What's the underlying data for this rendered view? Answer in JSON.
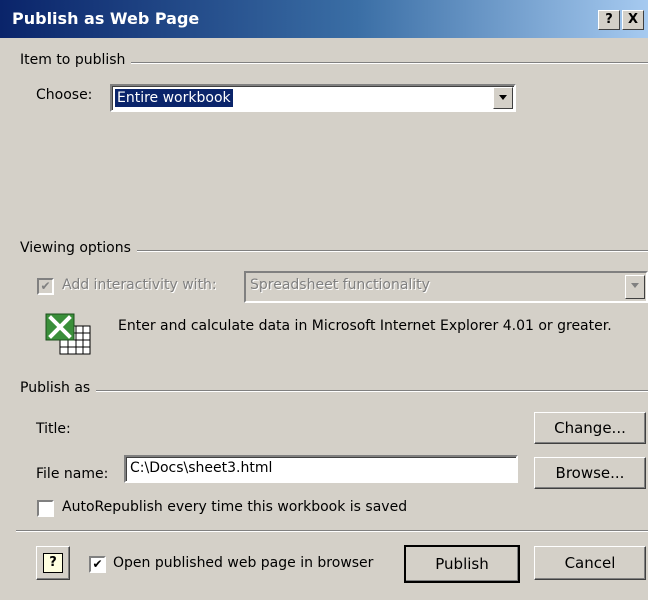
{
  "window": {
    "title": "Publish as Web Page",
    "help_button": "?",
    "close_button": "X"
  },
  "item_to_publish": {
    "group_label": "Item to publish",
    "choose_label": "Choose:",
    "choose_value": "Entire workbook"
  },
  "viewing_options": {
    "group_label": "Viewing options",
    "interactivity_label": "Add interactivity with:",
    "interactivity_checked": true,
    "interactivity_value": "Spreadsheet functionality",
    "description": "Enter and calculate data in Microsoft Internet Explorer 4.01 or greater.",
    "icon": "excel-spreadsheet-icon"
  },
  "publish_as": {
    "group_label": "Publish as",
    "title_label": "Title:",
    "change_button": "Change...",
    "file_name_label": "File name:",
    "file_name_value": "C:\\Docs\\sheet3.html",
    "browse_button": "Browse...",
    "autorepublish_label": "AutoRepublish every time this workbook is saved",
    "autorepublish_checked": false
  },
  "footer": {
    "help_icon": "question-help-icon",
    "open_in_browser_label": "Open published web page in browser",
    "open_in_browser_checked": true,
    "publish_button": "Publish",
    "cancel_button": "Cancel"
  }
}
